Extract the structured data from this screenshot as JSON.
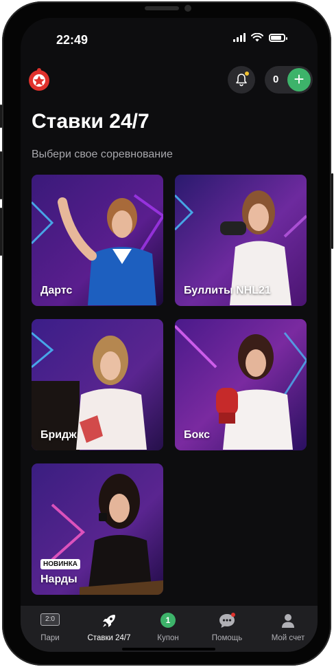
{
  "status_bar": {
    "time": "22:49"
  },
  "header": {
    "balance": "0",
    "add_symbol": "+"
  },
  "page": {
    "title": "Ставки 24/7",
    "subtitle": "Выбери свое соревнование"
  },
  "games": [
    {
      "label": "Дартс"
    },
    {
      "label": "Буллиты NHL21"
    },
    {
      "label": "Бридж"
    },
    {
      "label": "Бокс"
    },
    {
      "label": "Нарды",
      "badge": "НОВИНКА"
    }
  ],
  "tabbar": {
    "items": [
      {
        "label": "Пари",
        "icon_text": "2:0",
        "icon": "score-icon"
      },
      {
        "label": "Ставки 24/7",
        "icon": "rocket-icon"
      },
      {
        "label": "Купон",
        "icon_text": "1",
        "icon": "coupon-icon"
      },
      {
        "label": "Помощь",
        "icon": "chat-icon"
      },
      {
        "label": "Мой счет",
        "icon": "user-icon"
      }
    ],
    "active_index": 1
  },
  "colors": {
    "accent_green": "#3db36a",
    "notification_dot": "#f1c232",
    "logo_red": "#e0322d"
  }
}
